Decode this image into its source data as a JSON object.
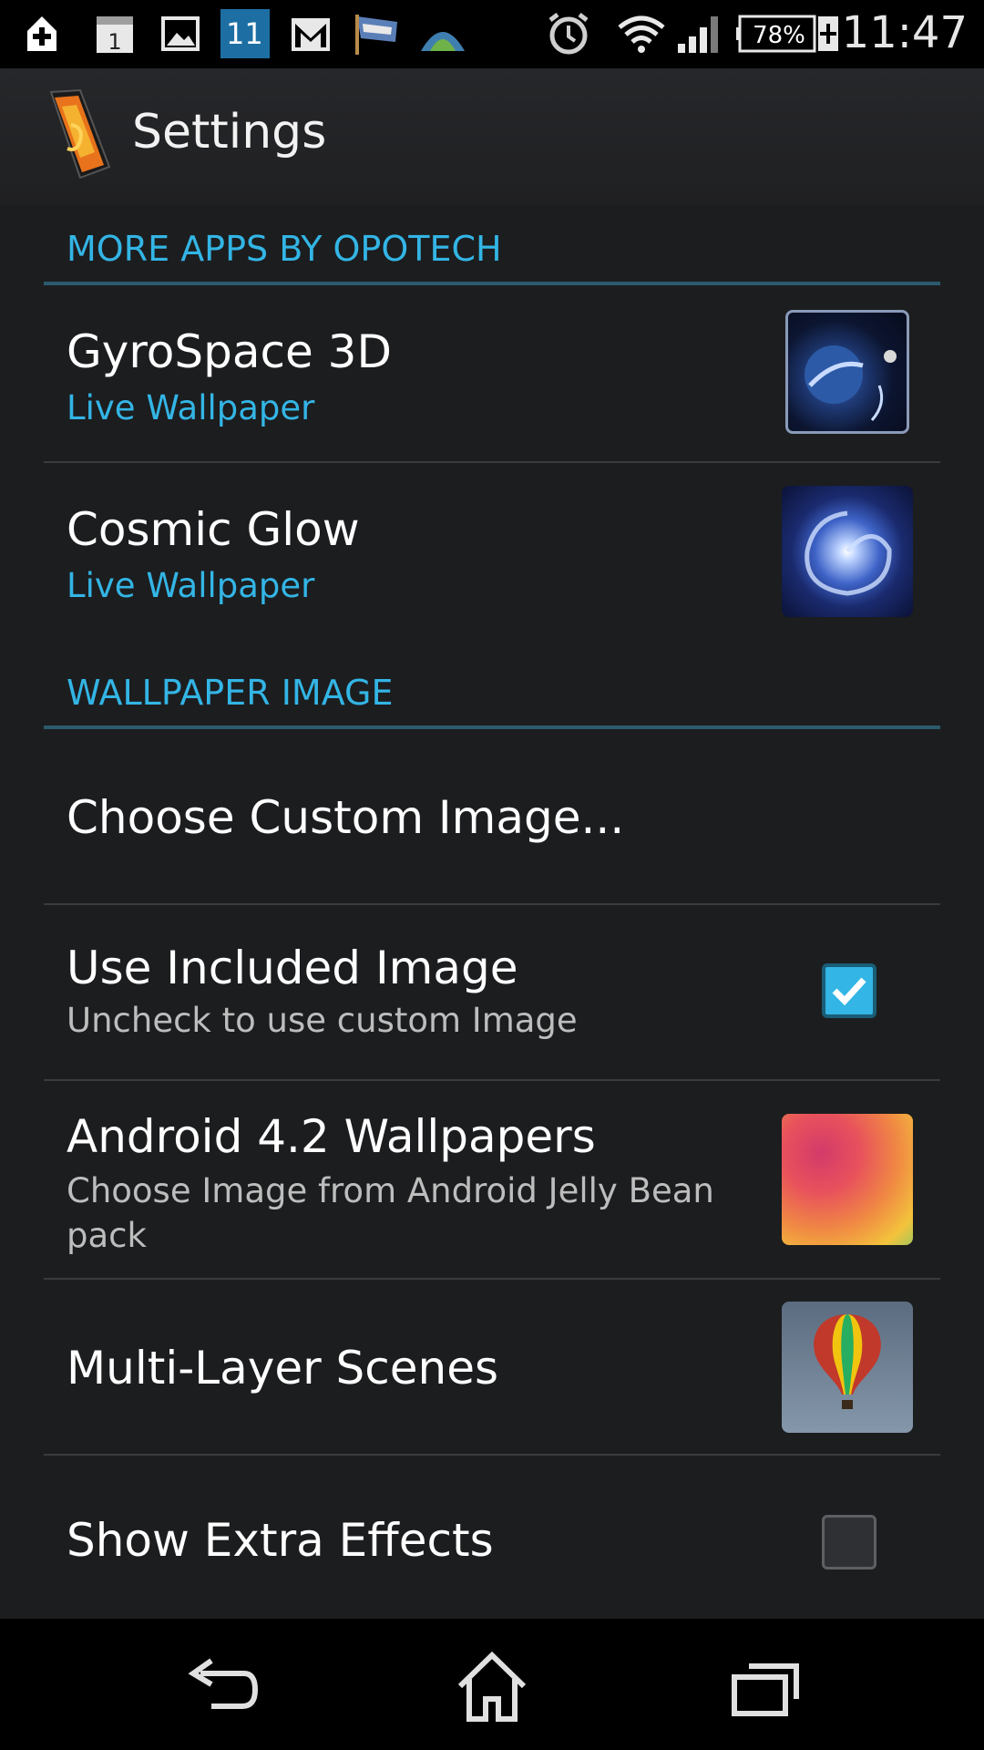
{
  "status_bar": {
    "time": "11:47",
    "battery_percent": "78%",
    "notification_icons": [
      "plus-icon",
      "calendar-icon",
      "image-icon",
      "weather-icon",
      "gmail-icon",
      "flag-icon",
      "tent-icon"
    ],
    "calendar_day": "1",
    "weather_temp": "11",
    "system_icons": [
      "alarm-icon",
      "wifi-icon",
      "signal-icon",
      "battery-icon"
    ]
  },
  "action_bar": {
    "title": "Settings"
  },
  "sections": {
    "more_apps": {
      "header": "MORE APPS BY OPOTECH",
      "items": [
        {
          "title": "GyroSpace 3D",
          "subtitle": "Live Wallpaper"
        },
        {
          "title": "Cosmic Glow",
          "subtitle": "Live Wallpaper"
        }
      ]
    },
    "wallpaper_image": {
      "header": "WALLPAPER IMAGE",
      "choose_custom": {
        "title": "Choose Custom Image..."
      },
      "use_included": {
        "title": "Use Included Image",
        "subtitle": "Uncheck to use custom Image",
        "checked": true
      },
      "android_wallpapers": {
        "title": "Android 4.2 Wallpapers",
        "subtitle": "Choose Image from Android Jelly Bean pack"
      },
      "multi_layer": {
        "title": "Multi-Layer Scenes"
      },
      "extra_effects": {
        "title": "Show Extra Effects",
        "checked": false
      }
    }
  },
  "nav_bar": {
    "buttons": [
      "back-icon",
      "home-icon",
      "recent-apps-icon"
    ]
  },
  "colors": {
    "accent": "#33b5e5",
    "background": "#1c1d1f",
    "divider": "#3a3b3d",
    "section_divider": "#2c5a6e"
  }
}
